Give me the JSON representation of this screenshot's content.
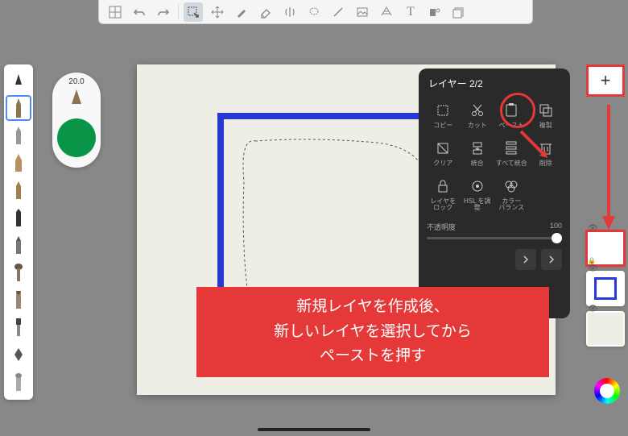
{
  "toolbar": {
    "tools": [
      "grid",
      "undo",
      "redo",
      "select",
      "move",
      "brush",
      "eraser",
      "mirror",
      "lasso",
      "line",
      "image",
      "perspective",
      "text",
      "reference",
      "gallery"
    ]
  },
  "brush_panel": {
    "size_label": "20.0",
    "brushes": [
      "pencil-1",
      "pencil-2",
      "pencil-3",
      "pencil-4",
      "pen",
      "marker",
      "brush-round",
      "brush-flat",
      "airbrush",
      "fill",
      "smudge"
    ]
  },
  "layer_panel": {
    "title": "レイヤー 2/2",
    "actions": [
      {
        "icon": "copy",
        "label": "コピー"
      },
      {
        "icon": "cut",
        "label": "カット"
      },
      {
        "icon": "paste",
        "label": "ペースト"
      },
      {
        "icon": "duplicate",
        "label": "複製"
      },
      {
        "icon": "clear",
        "label": "クリア"
      },
      {
        "icon": "merge",
        "label": "統合"
      },
      {
        "icon": "merge-all",
        "label": "すべて統合"
      },
      {
        "icon": "delete",
        "label": "削除"
      },
      {
        "icon": "lock",
        "label": "レイヤを\nロック"
      },
      {
        "icon": "hsl",
        "label": "HSL を調整"
      },
      {
        "icon": "color-balance",
        "label": "カラー\nバランス"
      }
    ],
    "opacity_label": "不透明度",
    "opacity_value": "100"
  },
  "instruction": {
    "text": "新規レイヤを作成後、\n新しいレイヤを選択してから\nペーストを押す"
  },
  "add_button_label": "+"
}
